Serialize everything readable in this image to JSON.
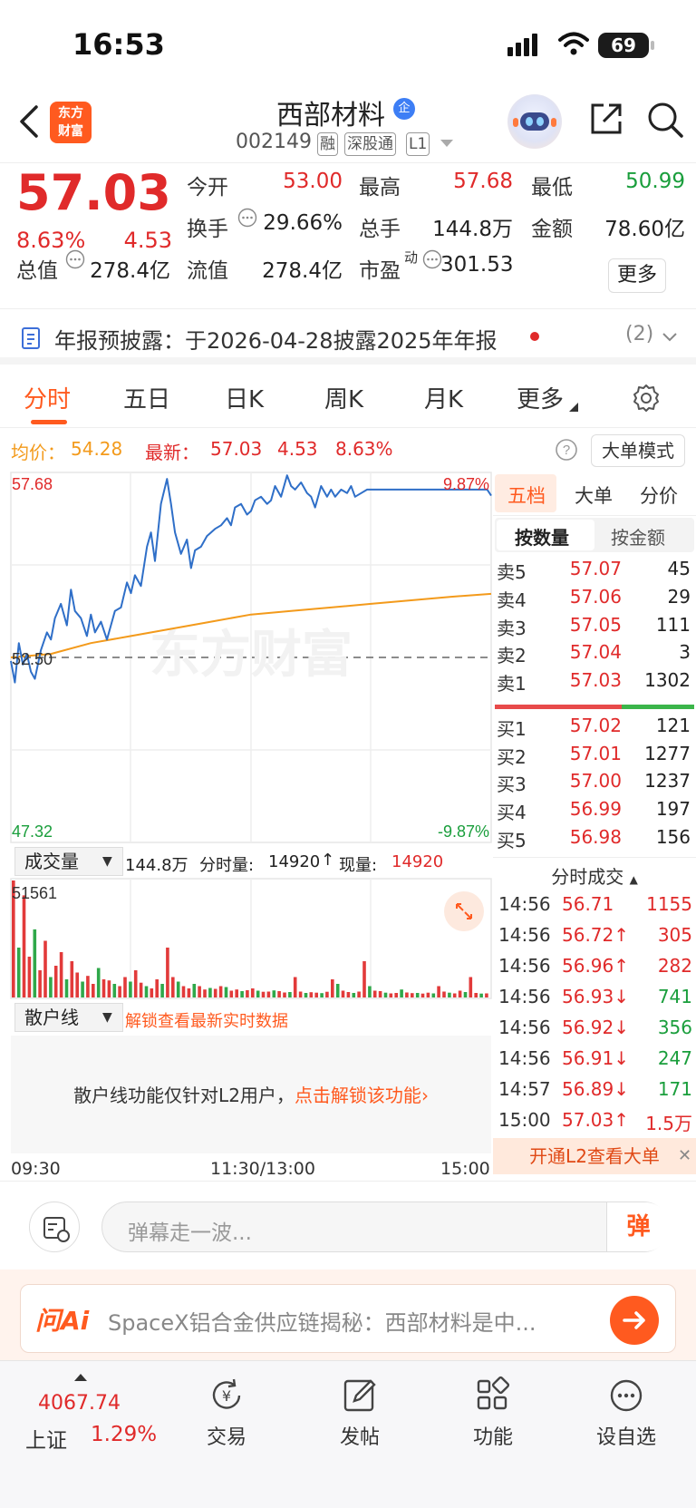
{
  "status_bar": {
    "time": "16:53",
    "battery": "69"
  },
  "header": {
    "logo_text": "东方财富",
    "stock_name": "西部材料",
    "badge": "企",
    "stock_code": "002149",
    "tags": [
      "融",
      "深股通",
      "L1"
    ]
  },
  "quote": {
    "price": "57.03",
    "change_pct": "8.63%",
    "change": "4.53",
    "fields": [
      {
        "label": "今开",
        "value": "53.00",
        "color": "#e02a2a"
      },
      {
        "label": "最高",
        "value": "57.68",
        "color": "#e02a2a"
      },
      {
        "label": "最低",
        "value": "50.99",
        "color": "#1a9e3c"
      },
      {
        "label": "换手",
        "value": "29.66%",
        "color": "#222222"
      },
      {
        "label": "总手",
        "value": "144.8万",
        "color": "#222222"
      },
      {
        "label": "金额",
        "value": "78.60亿",
        "color": "#222222"
      },
      {
        "label": "总值",
        "value": "278.4亿",
        "color": "#222222"
      },
      {
        "label": "流值",
        "value": "278.4亿",
        "color": "#222222"
      },
      {
        "label": "市盈",
        "value": "301.53",
        "color": "#222222"
      }
    ],
    "pe_superscript": "动",
    "more_label": "更多"
  },
  "notice": {
    "text": "年报预披露：于2026-04-28披露2025年年报",
    "count": "(2)"
  },
  "tabs": [
    "分时",
    "五日",
    "日K",
    "周K",
    "月K",
    "更多"
  ],
  "info_line": {
    "avg_label": "均价：",
    "avg_value": "54.28",
    "latest_label": "最新：",
    "latest_value": "57.03",
    "change": "4.53",
    "change_pct": "8.63%",
    "big_order_mode": "大单模式"
  },
  "chart_data": {
    "type": "line",
    "title": "",
    "x_range": [
      "09:30",
      "15:00"
    ],
    "x_ticks": [
      "09:30",
      "11:30/13:00",
      "15:00"
    ],
    "y_max_label": "57.68",
    "y_min_label": "47.32",
    "y_ref_label": "52.50",
    "pct_max_label": "9.87%",
    "pct_min_label": "-9.87%",
    "ylim": [
      47.32,
      57.68
    ],
    "watermark": "东方财富",
    "series": [
      {
        "name": "",
        "color": "#2f6fc8",
        "x": [
          0,
          2,
          4,
          6,
          8,
          10,
          12,
          15,
          18,
          20,
          22,
          25,
          28,
          30,
          32,
          35,
          38,
          40,
          42,
          45,
          48,
          50,
          52,
          55,
          58,
          60,
          62,
          65,
          68,
          70,
          72,
          75,
          78,
          80,
          82,
          85,
          88,
          90,
          92,
          95,
          98,
          100,
          102,
          105,
          108,
          110,
          112,
          115,
          118,
          120,
          122,
          125,
          128,
          130,
          132,
          135,
          138,
          140,
          142,
          145,
          148,
          150,
          152,
          155,
          158,
          160,
          162,
          165,
          168,
          170,
          172,
          175,
          178,
          180,
          182,
          185,
          188,
          190,
          192,
          195,
          198,
          200,
          202,
          205,
          208,
          210,
          212,
          215,
          218,
          220,
          222,
          225,
          228,
          230,
          232,
          235,
          238,
          240
        ],
        "values": [
          52.4,
          51.8,
          52.9,
          52.3,
          52.6,
          52.1,
          51.9,
          52.7,
          53.2,
          53.0,
          53.6,
          54.0,
          53.4,
          54.4,
          53.8,
          53.6,
          53.1,
          53.7,
          53.2,
          53.5,
          53.0,
          53.4,
          53.8,
          53.9,
          54.6,
          54.3,
          54.8,
          54.5,
          55.6,
          56.0,
          55.2,
          56.8,
          57.5,
          56.8,
          56.0,
          55.4,
          55.8,
          55.0,
          55.5,
          55.6,
          55.9,
          56.0,
          56.1,
          56.2,
          56.4,
          56.2,
          56.7,
          56.8,
          56.5,
          56.6,
          56.9,
          57.0,
          56.8,
          56.9,
          57.3,
          57.0,
          57.6,
          57.3,
          57.2,
          57.4,
          57.1,
          57.0,
          56.7,
          57.3,
          57.0,
          57.2,
          57.0,
          57.2,
          57.1,
          57.3,
          57.0,
          57.1,
          57.2,
          57.2,
          57.2,
          57.2,
          57.2,
          57.2,
          57.2,
          57.2,
          57.2,
          57.2,
          57.2,
          57.2,
          57.2,
          57.2,
          57.2,
          57.2,
          57.2,
          57.2,
          57.2,
          57.2,
          57.2,
          57.2,
          57.2,
          57.2,
          57.2,
          57.03
        ]
      },
      {
        "name": "均价",
        "color": "#f39a1b",
        "x": [
          0,
          20,
          40,
          60,
          80,
          100,
          120,
          140,
          160,
          180,
          200,
          220,
          240
        ],
        "values": [
          52.5,
          52.6,
          52.9,
          53.1,
          53.3,
          53.5,
          53.7,
          53.8,
          53.9,
          54.0,
          54.1,
          54.2,
          54.28
        ]
      }
    ],
    "volume": {
      "name": "成交量",
      "max_label": "51561",
      "total_label": "144.8万",
      "period_label": "分时量:",
      "period_value": "14920",
      "current_label": "现量:",
      "current_value": "14920",
      "bars": [
        51561,
        22000,
        45000,
        18000,
        30000,
        12000,
        25000,
        9000,
        14000,
        20000,
        8000,
        16000,
        11000,
        7000,
        9500,
        6000,
        13000,
        8000,
        7500,
        6000,
        5000,
        9000,
        7000,
        12000,
        6500,
        5000,
        4000,
        8000,
        6000,
        22000,
        9000,
        7000,
        5000,
        4000,
        6000,
        5000,
        3500,
        4200,
        3800,
        5000,
        4600,
        3000,
        3500,
        2800,
        3200,
        4000,
        3000,
        2500,
        2600,
        3100,
        2800,
        2200,
        2400,
        9000,
        2600,
        2000,
        2300,
        2100,
        1900,
        2500,
        8000,
        6000,
        3000,
        2400,
        2000,
        2600,
        16000,
        5000,
        3000,
        2800,
        2100,
        1800,
        2000,
        3500,
        2200,
        1900,
        2000,
        1700,
        2100,
        1800,
        5000,
        2600,
        2100,
        1800,
        3000,
        2400,
        9000,
        2000,
        1700,
        1800
      ]
    }
  },
  "retail": {
    "select_label": "散户线",
    "unlock_hint": "解锁查看最新实时数据",
    "msg": "散户线功能仅针对L2用户，",
    "msg_link": "点击解锁该功能"
  },
  "order_book": {
    "tabs": [
      "五档",
      "大单",
      "分价"
    ],
    "sub_tabs": [
      "按数量",
      "按金额"
    ],
    "asks": [
      {
        "label": "卖5",
        "price": "57.07",
        "vol": "45"
      },
      {
        "label": "卖4",
        "price": "57.06",
        "vol": "29"
      },
      {
        "label": "卖3",
        "price": "57.05",
        "vol": "111"
      },
      {
        "label": "卖2",
        "price": "57.04",
        "vol": "3"
      },
      {
        "label": "卖1",
        "price": "57.03",
        "vol": "1302"
      }
    ],
    "bids": [
      {
        "label": "买1",
        "price": "57.02",
        "vol": "121"
      },
      {
        "label": "买2",
        "price": "57.01",
        "vol": "1277"
      },
      {
        "label": "买3",
        "price": "57.00",
        "vol": "1237"
      },
      {
        "label": "买4",
        "price": "56.99",
        "vol": "197"
      },
      {
        "label": "买5",
        "price": "56.98",
        "vol": "156"
      }
    ],
    "ticks_header": "分时成交",
    "ticks": [
      {
        "time": "14:56",
        "price": "56.71",
        "vol": "1155",
        "price_color": "#e02a2a",
        "vol_color": "#e02a2a"
      },
      {
        "time": "14:56",
        "price": "56.72↑",
        "vol": "305",
        "price_color": "#e02a2a",
        "vol_color": "#e02a2a"
      },
      {
        "time": "14:56",
        "price": "56.96↑",
        "vol": "282",
        "price_color": "#e02a2a",
        "vol_color": "#e02a2a"
      },
      {
        "time": "14:56",
        "price": "56.93↓",
        "vol": "741",
        "price_color": "#e02a2a",
        "vol_color": "#1a9e3c"
      },
      {
        "time": "14:56",
        "price": "56.92↓",
        "vol": "356",
        "price_color": "#e02a2a",
        "vol_color": "#1a9e3c"
      },
      {
        "time": "14:56",
        "price": "56.91↓",
        "vol": "247",
        "price_color": "#e02a2a",
        "vol_color": "#1a9e3c"
      },
      {
        "time": "14:57",
        "price": "56.89↓",
        "vol": "171",
        "price_color": "#e02a2a",
        "vol_color": "#1a9e3c"
      },
      {
        "time": "15:00",
        "price": "57.03↑",
        "vol": "1.5万",
        "price_color": "#e02a2a",
        "vol_color": "#e02a2a"
      }
    ],
    "l2_banner": "开通L2查看大单"
  },
  "danmu": {
    "placeholder": "弹幕走一波...",
    "button": "弹"
  },
  "ai_banner": {
    "logo": "问Ai",
    "text": "SpaceX铝合金供应链揭秘：西部材料是中..."
  },
  "bottom_nav": {
    "index_value": "4067.74",
    "index_name": "上证",
    "index_pct": "1.29%",
    "items": [
      "交易",
      "发帖",
      "功能",
      "设自选"
    ]
  }
}
